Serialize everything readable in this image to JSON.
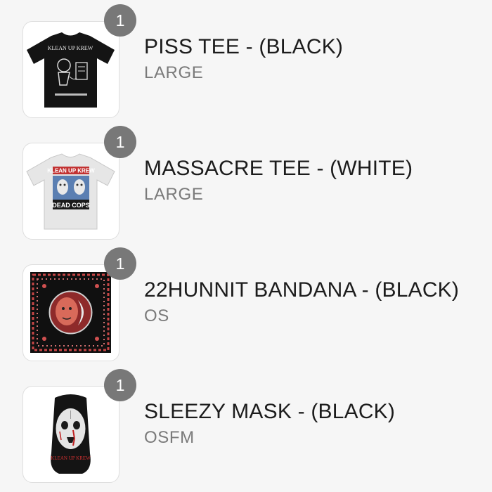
{
  "cart": {
    "items": [
      {
        "quantity": "1",
        "title": "PISS TEE - (BLACK)",
        "variant": "LARGE",
        "image_icon": "black-tshirt-icon",
        "print_text": "KLEAN UP KREW"
      },
      {
        "quantity": "1",
        "title": "MASSACRE TEE - (WHITE)",
        "variant": "LARGE",
        "image_icon": "white-tshirt-icon",
        "print_text": "KLEAN UP KREW",
        "print_subtext": "DEAD COPS"
      },
      {
        "quantity": "1",
        "title": "22HUNNIT BANDANA - (BLACK)",
        "variant": "OS",
        "image_icon": "bandana-icon"
      },
      {
        "quantity": "1",
        "title": "SLEEZY MASK - (BLACK)",
        "variant": "OSFM",
        "image_icon": "ski-mask-icon",
        "print_text": "KLEAN UP KREW"
      }
    ]
  },
  "colors": {
    "badge": "#787878",
    "title": "#1c1c1c",
    "variant": "#7a7a7a",
    "background": "#f6f6f6"
  }
}
